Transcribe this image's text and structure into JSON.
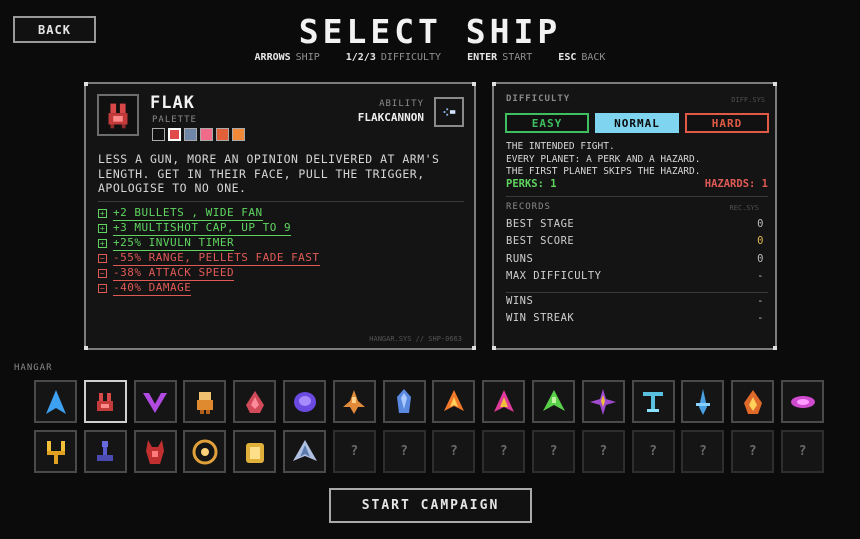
{
  "header": {
    "back_label": "BACK",
    "title": "SELECT SHIP",
    "controls": [
      {
        "key": "ARROWS",
        "action": "SHIP"
      },
      {
        "key": "1/2/3",
        "action": "DIFFICULTY"
      },
      {
        "key": "ENTER",
        "action": "START"
      },
      {
        "key": "ESC",
        "action": "BACK"
      }
    ]
  },
  "ship": {
    "name": "FLAK",
    "palette_label": "PALETTE",
    "palette": [
      "#111111",
      "#e04a4a",
      "#6f86a8",
      "#f06a8a",
      "#e0603a",
      "#f08a3a"
    ],
    "ability_label": "ABILITY",
    "ability_name": "FLAKCANNON",
    "ability_icon": "flak-burst-icon",
    "description": "LESS A GUN, MORE AN OPINION DELIVERED AT ARM'S LENGTH. GET IN THEIR FACE, PULL THE TRIGGER, APOLOGISE TO NO ONE.",
    "perks": [
      {
        "sign": "+",
        "text": "+2 BULLETS , WIDE FAN"
      },
      {
        "sign": "+",
        "text": "+3 MULTISHOT CAP, UP TO 9"
      },
      {
        "sign": "+",
        "text": "+25% INVULN TIMER"
      }
    ],
    "drawbacks": [
      {
        "sign": "-",
        "text": "-55% RANGE, PELLETS FADE FAST"
      },
      {
        "sign": "-",
        "text": "-38% ATTACK SPEED"
      },
      {
        "sign": "-",
        "text": "-40% DAMAGE"
      }
    ],
    "footer": "HANGAR.SYS // SHP-0663"
  },
  "difficulty": {
    "label": "DIFFICULTY",
    "sys": "DIFF.SYS",
    "options": [
      {
        "label": "EASY",
        "color": "#3fbf5f",
        "selected": false
      },
      {
        "label": "NORMAL",
        "color": "#7fd4f0",
        "selected": true
      },
      {
        "label": "HARD",
        "color": "#e05a45",
        "selected": false
      }
    ],
    "desc_lines": [
      "THE INTENDED FIGHT.",
      "EVERY PLANET: A PERK AND A HAZARD.",
      "THE FIRST PLANET SKIPS THE HAZARD."
    ],
    "perks_label": "PERKS:",
    "perks_value": "1",
    "hazards_label": "HAZARDS:",
    "hazards_value": "1"
  },
  "records": {
    "label": "RECORDS",
    "sys": "REC.SYS",
    "rows": [
      {
        "label": "BEST STAGE",
        "value": "0"
      },
      {
        "label": "BEST SCORE",
        "value": "0"
      },
      {
        "label": "RUNS",
        "value": "0"
      },
      {
        "label": "MAX DIFFICULTY",
        "value": "-"
      }
    ],
    "rows2": [
      {
        "label": "WINS",
        "value": "-"
      },
      {
        "label": "WIN STREAK",
        "value": "-"
      }
    ]
  },
  "hangar": {
    "label": "HANGAR",
    "row1": [
      "arrow-ship-icon",
      "flak-ship-icon",
      "chevron-ship-icon",
      "golem-ship-icon",
      "drop-ship-icon",
      "orb-ship-icon",
      "dart-ship-icon",
      "crystal-ship-icon",
      "flame-ship-icon",
      "magenta-ship-icon",
      "green-ship-icon",
      "spark-ship-icon",
      "anchor-ship-icon",
      "blade-ship-icon",
      "fire-ship-icon",
      "cloud-ship-icon"
    ],
    "row2": [
      "fork-ship-icon",
      "pawn-ship-icon",
      "demon-ship-icon",
      "core-ship-icon",
      "jar-ship-icon",
      "wing-ship-icon",
      "?",
      "?",
      "?",
      "?",
      "?",
      "?",
      "?",
      "?",
      "?",
      "?"
    ],
    "locked_glyph": "?"
  },
  "start_label": "START CAMPAIGN"
}
